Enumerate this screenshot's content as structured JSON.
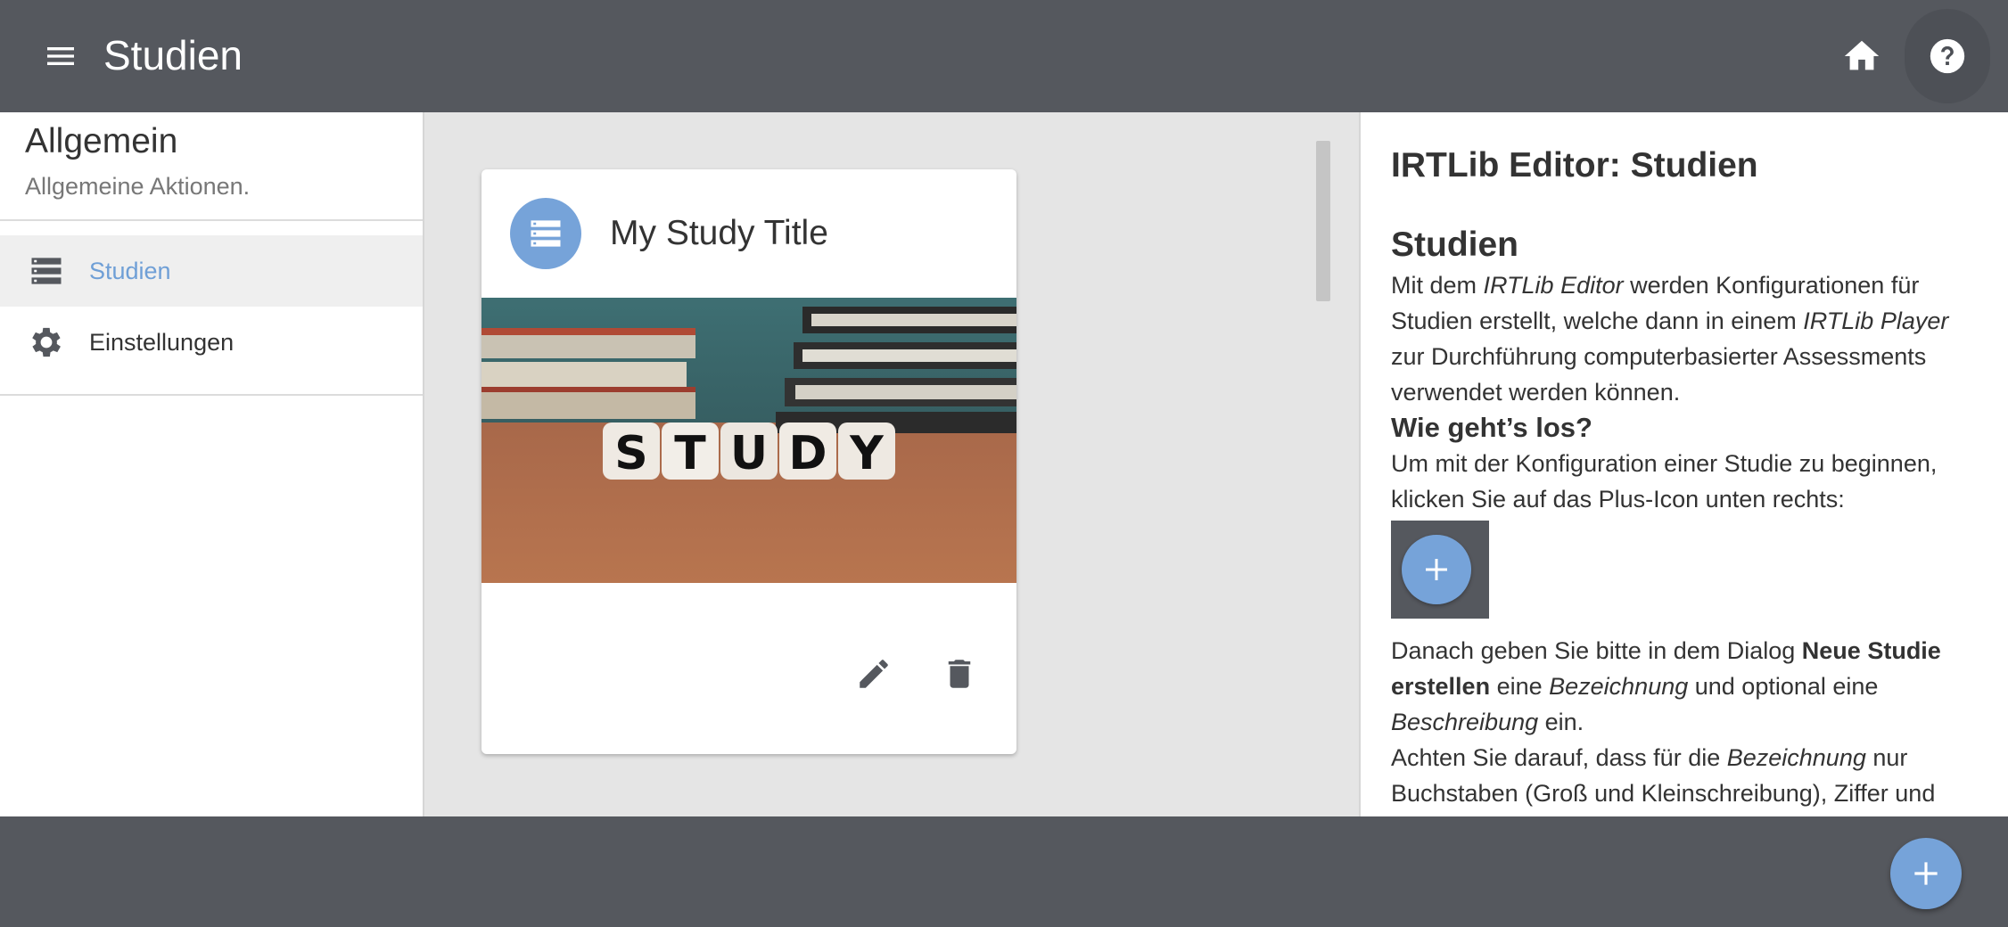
{
  "app_bar": {
    "title": "Studien",
    "menu_icon": "menu-icon",
    "home_icon": "home-icon",
    "help_icon": "help-icon"
  },
  "sidebar": {
    "section_title": "Allgemein",
    "section_subtitle": "Allgemeine Aktionen.",
    "items": [
      {
        "label": "Studien",
        "icon": "list-icon",
        "active": true
      },
      {
        "label": "Einstellungen",
        "icon": "gear-icon",
        "active": false
      }
    ]
  },
  "study_card": {
    "title": "My Study Title",
    "avatar_icon": "study-list-icon",
    "image_text": "STUDY",
    "edit_icon": "pencil-icon",
    "delete_icon": "trash-icon"
  },
  "help_panel": {
    "title": "IRTLib Editor: Studien",
    "heading": "Studien",
    "p1": {
      "a": "Mit dem ",
      "b": "IRTLib Editor",
      "c": " werden Konfigurationen für Studien erstellt, welche dann in einem ",
      "d": "IRTLib Player",
      "e": " zur Durchführung computerbasierter Assessments verwendet werden können."
    },
    "subheading": "Wie geht’s los?",
    "p2": "Um mit der Konfiguration einer Studie zu beginnen, klicken Sie auf das Plus-Icon unten rechts:",
    "p3": {
      "a": "Danach geben Sie bitte in dem Dialog ",
      "b": "Neue Studie erstellen",
      "c": " eine ",
      "d": "Bezeichnung",
      "e": " und optional eine ",
      "f": "Beschreibung",
      "g": " ein."
    },
    "p4": {
      "a": "Achten Sie darauf, dass für die ",
      "b": "Bezeichnung",
      "c": " nur Buchstaben (Groß und Kleinschreibung), Ziffer und"
    }
  },
  "colors": {
    "bar": "#55585e",
    "accent": "#76a3d9",
    "active_text": "#6f9fd6"
  }
}
